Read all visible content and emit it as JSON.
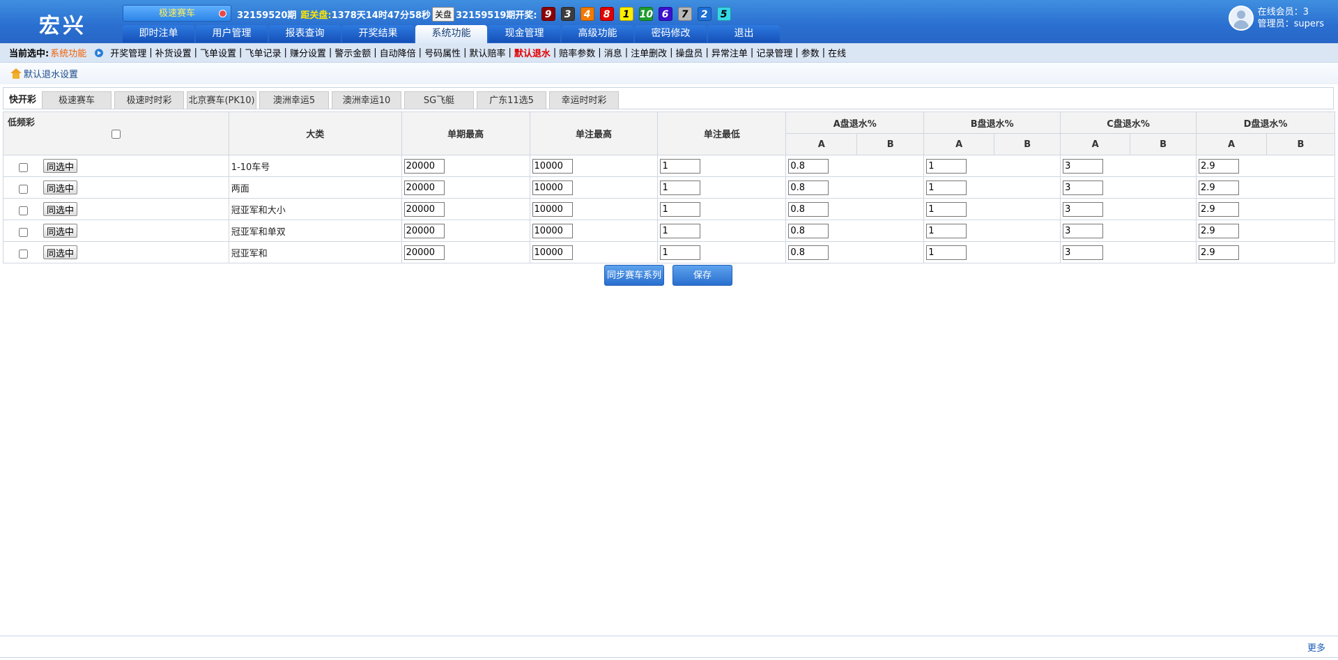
{
  "brand": "宏兴",
  "game_selector": "极速赛车",
  "status": {
    "current_period": "32159520期",
    "close_label": "距关盘:",
    "countdown": "1378天14时47分58秒",
    "close_button": "关盘",
    "last_period": "32159519期开奖:",
    "balls": [
      {
        "n": "9",
        "color": "#8a0000"
      },
      {
        "n": "3",
        "color": "#3c3c3c"
      },
      {
        "n": "4",
        "color": "#f27a00"
      },
      {
        "n": "8",
        "color": "#e00000"
      },
      {
        "n": "1",
        "color": "#ffee00"
      },
      {
        "n": "10",
        "color": "#1f9c2c"
      },
      {
        "n": "6",
        "color": "#3a10cc"
      },
      {
        "n": "7",
        "color": "#b8b8b8"
      },
      {
        "n": "2",
        "color": "#1d6fd6"
      },
      {
        "n": "5",
        "color": "#35d6e6"
      }
    ]
  },
  "nav": {
    "tabs": [
      "即时注单",
      "用户管理",
      "报表查询",
      "开奖结果",
      "系统功能",
      "现金管理",
      "高级功能",
      "密码修改",
      "退出"
    ],
    "active": "系统功能"
  },
  "user": {
    "online": "在线会员：3",
    "admin": "管理员：supers"
  },
  "subnav": {
    "label": "当前选中:",
    "current": "系统功能",
    "items": [
      "开奖管理",
      "补货设置",
      "飞单设置",
      "飞单记录",
      "赚分设置",
      "警示金额",
      "自动降倍",
      "号码属性",
      "默认赔率",
      "默认退水",
      "赔率参数",
      "消息",
      "注单删改",
      "操盘员",
      "异常注单",
      "记录管理",
      "参数",
      "在线"
    ],
    "active": "默认退水"
  },
  "breadcrumb": "默认退水设置",
  "lottery_tabs": {
    "label": "快开彩",
    "items": [
      "极速赛车",
      "极速时时彩",
      "北京赛车(PK10)",
      "澳洲幸运5",
      "澳洲幸运10",
      "SG飞艇",
      "广东11选5",
      "幸运时时彩"
    ]
  },
  "table": {
    "low_freq_label": "低频彩",
    "headers": {
      "category": "大类",
      "period_max": "单期最高",
      "bet_max": "单注最高",
      "bet_min": "单注最低",
      "a_rebate": "A盘退水%",
      "b_rebate": "B盘退水%",
      "c_rebate": "C盘退水%",
      "d_rebate": "D盘退水%",
      "sub_a": "A",
      "sub_b": "B"
    },
    "select_button": "同选中",
    "rows": [
      {
        "category": "1-10车号",
        "period_max": "20000",
        "bet_max": "10000",
        "bet_min": "1",
        "a": "0.8",
        "b": "1",
        "c": "3",
        "d": "2.9"
      },
      {
        "category": "两面",
        "period_max": "20000",
        "bet_max": "10000",
        "bet_min": "1",
        "a": "0.8",
        "b": "1",
        "c": "3",
        "d": "2.9"
      },
      {
        "category": "冠亚军和大小",
        "period_max": "20000",
        "bet_max": "10000",
        "bet_min": "1",
        "a": "0.8",
        "b": "1",
        "c": "3",
        "d": "2.9"
      },
      {
        "category": "冠亚军和单双",
        "period_max": "20000",
        "bet_max": "10000",
        "bet_min": "1",
        "a": "0.8",
        "b": "1",
        "c": "3",
        "d": "2.9"
      },
      {
        "category": "冠亚军和",
        "period_max": "20000",
        "bet_max": "10000",
        "bet_min": "1",
        "a": "0.8",
        "b": "1",
        "c": "3",
        "d": "2.9"
      }
    ]
  },
  "actions": {
    "sync": "同步赛车系列",
    "save": "保存"
  },
  "footer": {
    "more": "更多"
  }
}
